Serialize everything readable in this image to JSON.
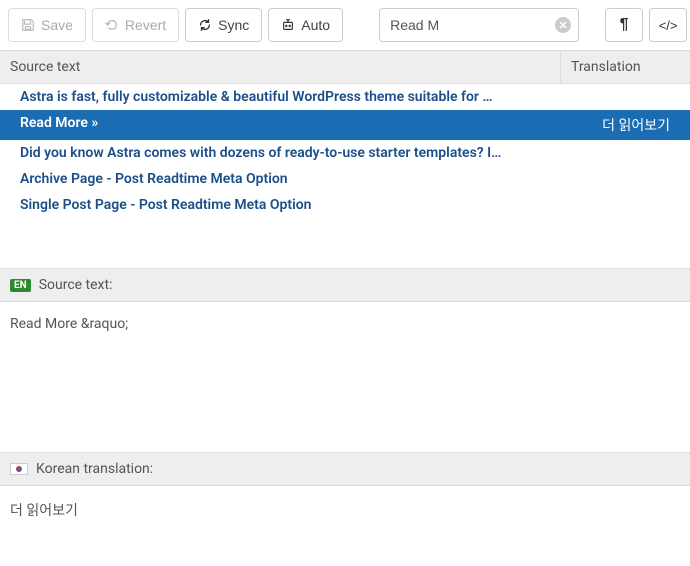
{
  "toolbar": {
    "save_label": "Save",
    "revert_label": "Revert",
    "sync_label": "Sync",
    "auto_label": "Auto"
  },
  "search": {
    "value": "Read M"
  },
  "table": {
    "source_header": "Source text",
    "translation_header": "Translation"
  },
  "rows": [
    {
      "source": "Astra is fast, fully customizable & beautiful WordPress theme suitable for …",
      "translation": "",
      "selected": false
    },
    {
      "source": "Read More »",
      "translation": "더 읽어보기",
      "selected": true
    },
    {
      "source": "Did you know Astra comes with dozens of ready-to-use starter templates? I…",
      "translation": "",
      "selected": false
    },
    {
      "source": "Archive Page - Post Readtime Meta Option",
      "translation": "",
      "selected": false
    },
    {
      "source": "Single Post Page - Post Readtime Meta Option",
      "translation": "",
      "selected": false
    }
  ],
  "source_pane": {
    "badge": "EN",
    "label": "Source text:",
    "content": "Read More &raquo;"
  },
  "translation_pane": {
    "label": "Korean translation:",
    "content": "더 읽어보기"
  }
}
